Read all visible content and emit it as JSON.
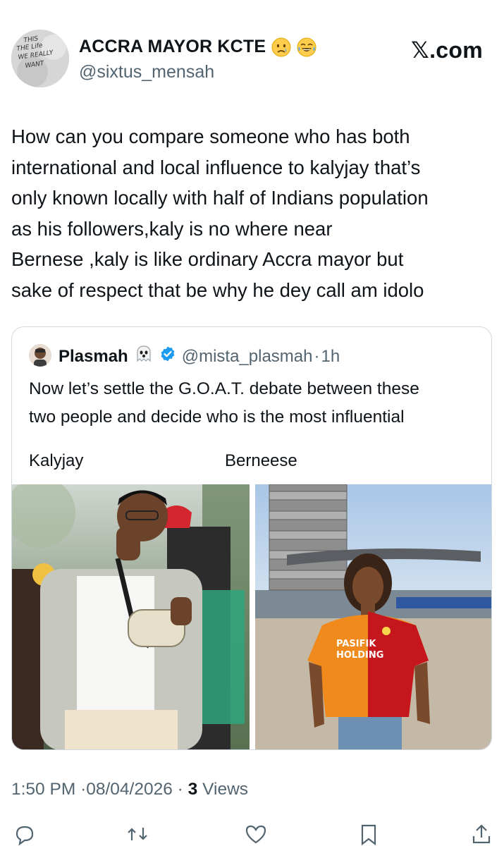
{
  "author": {
    "display_name": "ACCRA MAYOR KCTE",
    "handle": "@sixtus_mensah",
    "emojis": [
      "crying-face-icon",
      "tears-of-joy-icon"
    ]
  },
  "brand": "𝕏.com",
  "tweet": {
    "lines": [
      "How can you compare someone who has both",
      "international and local influence to kalyjay that’s",
      "only known locally with half of Indians population",
      "as his followers,kaly is no where near",
      "Bernese ,kaly  is like ordinary Accra mayor but",
      "sake of respect that be why he dey call am idolo"
    ]
  },
  "quoted": {
    "name": "Plasmah",
    "handle": "@mista_plasmah",
    "separator": "·",
    "time": "1h",
    "lines": [
      "Now let’s settle the G.O.A.T. debate between these",
      "two people and decide who is the most influential"
    ],
    "label_left": "Kalyjay",
    "label_right": "Berneese",
    "jersey_text_1": "PASIFIK",
    "jersey_text_2": "HOLDING"
  },
  "meta": {
    "time": "1:50 PM",
    "sep": "·",
    "date": "08/04/2026",
    "sep2": "·",
    "views_count": "3",
    "views_label": "Views"
  },
  "avatar_text": [
    "THIS",
    "THE Life",
    "WE REALLY",
    "WANT"
  ],
  "colors": {
    "text": "#0f1419",
    "secondary": "#536471",
    "border": "#cfd9de",
    "verified": "#1d9bf0"
  }
}
